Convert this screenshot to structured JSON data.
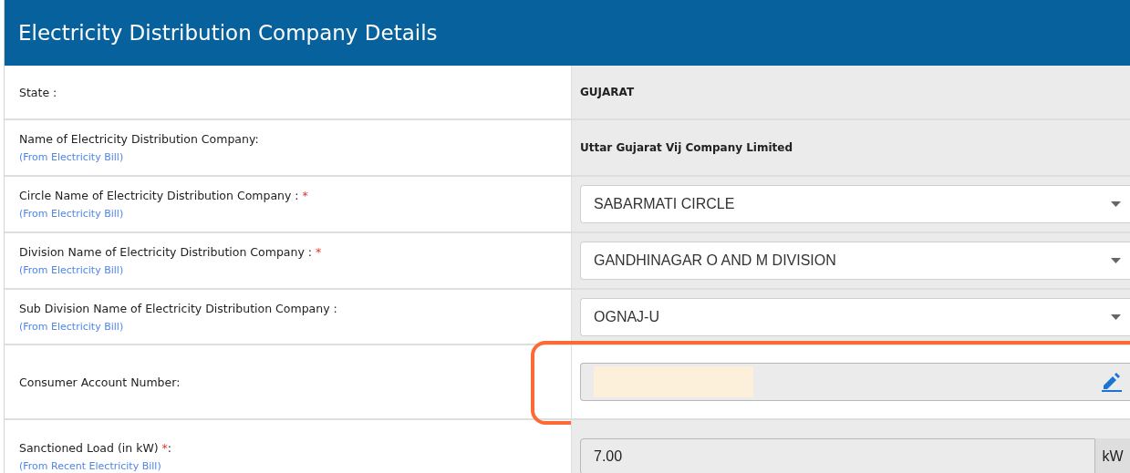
{
  "title": "Electricity Distribution Company Details",
  "rows": [
    {
      "label": "State :",
      "kind": "text",
      "value": "GUJARAT"
    },
    {
      "label": "Name of Electricity Distribution Company:",
      "note": "(From Electricity Bill)",
      "kind": "text",
      "value": "Uttar Gujarat Vij Company Limited"
    },
    {
      "label": "Circle Name of Electricity Distribution Company :",
      "mark": "*",
      "note": "(From Electricity Bill)",
      "kind": "select",
      "value": "SABARMATI CIRCLE"
    },
    {
      "label": "Division Name of Electricity Distribution Company :",
      "mark": "*",
      "note": "(From Electricity Bill)",
      "kind": "select",
      "value": "GANDHINAGAR O AND M DIVISION"
    },
    {
      "label": "Sub Division Name of Electricity Distribution Company :",
      "note": "(From Electricity Bill)",
      "kind": "select",
      "value": "OGNAJ-U"
    },
    {
      "label": "Consumer Account Number:",
      "kind": "editable",
      "redacted": true,
      "highlighted": true
    },
    {
      "label": "Sanctioned Load (in kW)",
      "mark": "*",
      "after": ":",
      "note": "(From Recent Electricity Bill)",
      "kind": "unit",
      "value": "7.00",
      "unit": "kW"
    }
  ]
}
